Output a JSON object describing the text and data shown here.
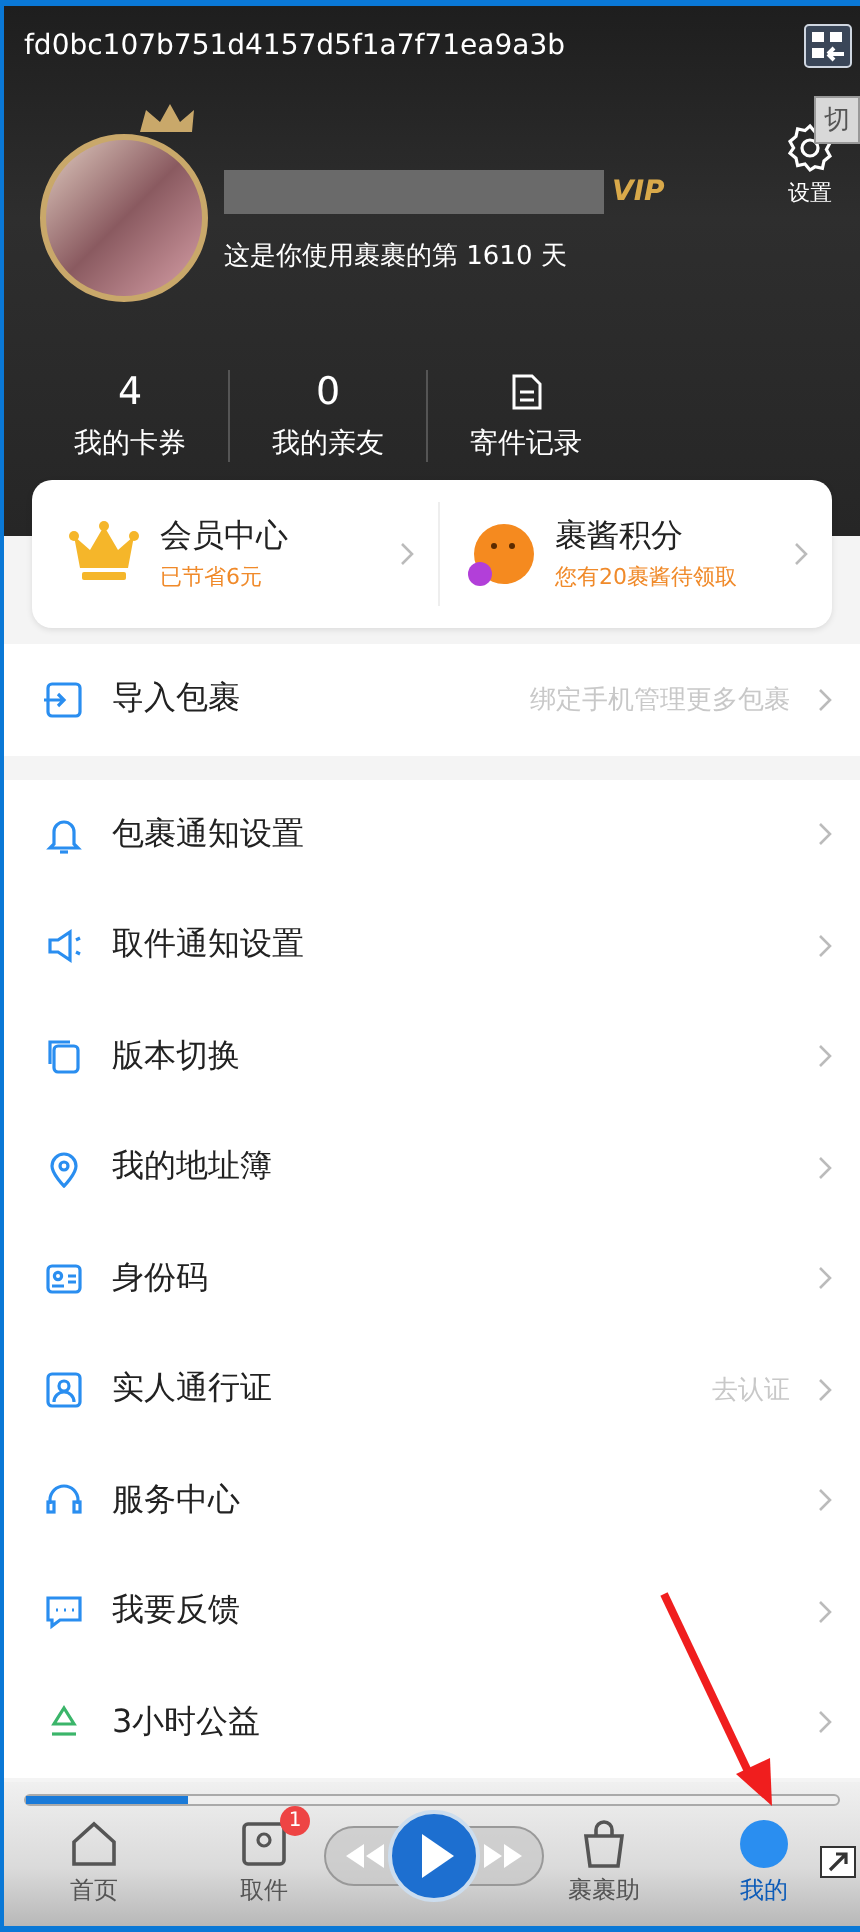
{
  "window": {
    "title": "fd0bc107b751d4157d5f1a7f71ea9a3b"
  },
  "tooltip": {
    "text": "切"
  },
  "profile": {
    "badge": "VIP",
    "days_text": "这是你使用裹裹的第 1610 天",
    "settings_label": "设置"
  },
  "stats": [
    {
      "value": "4",
      "label": "我的卡券"
    },
    {
      "value": "0",
      "label": "我的亲友"
    },
    {
      "label": "寄件记录"
    }
  ],
  "cards": [
    {
      "title": "会员中心",
      "subtitle": "已节省6元"
    },
    {
      "title": "裹酱积分",
      "subtitle": "您有20裹酱待领取"
    }
  ],
  "menu": [
    {
      "label": "导入包裹",
      "hint": "绑定手机管理更多包裹"
    },
    {
      "label": "包裹通知设置"
    },
    {
      "label": "取件通知设置"
    },
    {
      "label": "版本切换"
    },
    {
      "label": "我的地址簿"
    },
    {
      "label": "身份码"
    },
    {
      "label": "实人通行证",
      "hint": "去认证"
    },
    {
      "label": "服务中心"
    },
    {
      "label": "我要反馈"
    },
    {
      "label": "3小时公益"
    }
  ],
  "player": {
    "level": 0.2
  },
  "tabbar": [
    {
      "label": "首页",
      "selected": false
    },
    {
      "label": "取件",
      "selected": false,
      "badge": "1"
    },
    {
      "label": "裹裹助",
      "selected": false
    },
    {
      "label": "我的",
      "selected": true
    }
  ]
}
